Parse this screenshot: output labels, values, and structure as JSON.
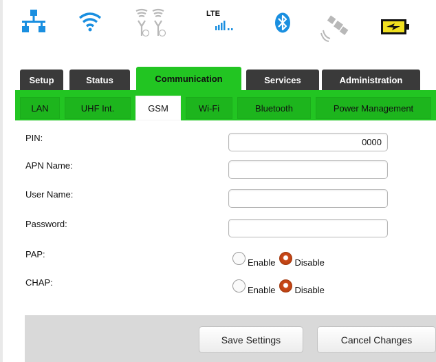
{
  "status_icons": {
    "network": "network-icon",
    "wifi": "wifi-icon",
    "antenna": "uhf-antenna-icon",
    "lte_label": "LTE",
    "lte_signal": "lte-signal-icon",
    "bluetooth": "bluetooth-icon",
    "satellite": "gps-satellite-icon",
    "battery": "battery-charging-icon",
    "colors": {
      "blue": "#1a8fe0",
      "gray": "#b8b8b8",
      "battery_yellow": "#f0e020"
    }
  },
  "main_tabs": [
    {
      "label": "Setup",
      "active": false
    },
    {
      "label": "Status",
      "active": false
    },
    {
      "label": "Communication",
      "active": true
    },
    {
      "label": "Services",
      "active": false
    },
    {
      "label": "Administration",
      "active": false
    }
  ],
  "sub_tabs": [
    {
      "label": "LAN",
      "active": false
    },
    {
      "label": "UHF Int.",
      "active": false
    },
    {
      "label": "GSM",
      "active": true
    },
    {
      "label": "Wi-Fi",
      "active": false
    },
    {
      "label": "Bluetooth",
      "active": false
    },
    {
      "label": "Power Management",
      "active": false
    }
  ],
  "form": {
    "pin": {
      "label": "PIN:",
      "value": "0000"
    },
    "apn": {
      "label": "APN Name:",
      "value": ""
    },
    "user": {
      "label": "User Name:",
      "value": ""
    },
    "password": {
      "label": "Password:",
      "value": ""
    },
    "pap": {
      "label": "PAP:",
      "enable_label": "Enable",
      "disable_label": "Disable",
      "selected": "Disable"
    },
    "chap": {
      "label": "CHAP:",
      "enable_label": "Enable",
      "disable_label": "Disable",
      "selected": "Disable"
    }
  },
  "buttons": {
    "save": "Save Settings",
    "cancel": "Cancel Changes"
  },
  "accent_color": "#22c522"
}
